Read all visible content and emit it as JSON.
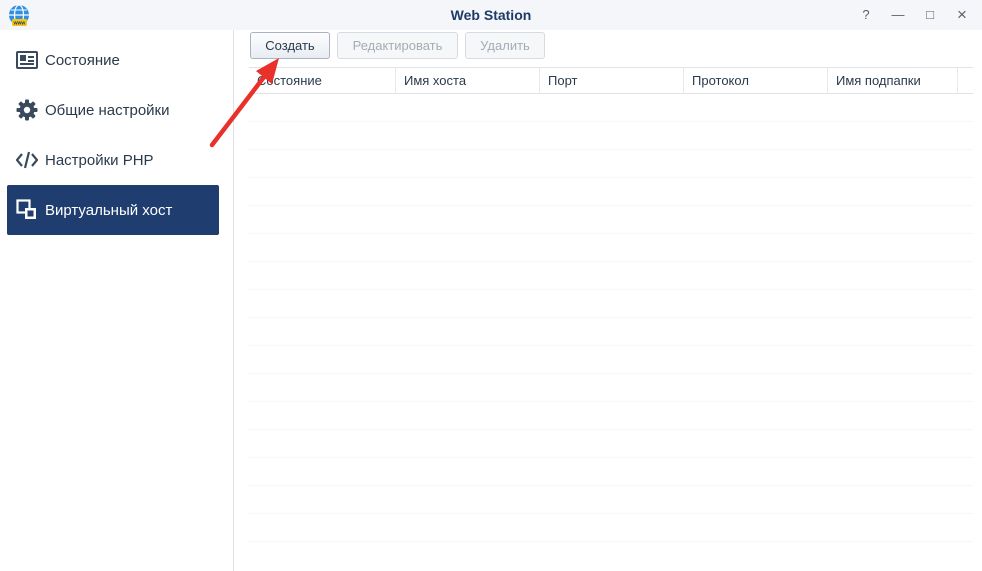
{
  "window": {
    "title": "Web Station",
    "controls": [
      "?",
      "—",
      "□",
      "×"
    ]
  },
  "sidebar": {
    "items": [
      {
        "label": "Состояние",
        "icon": "status-card-icon",
        "active": false
      },
      {
        "label": "Общие настройки",
        "icon": "gear-icon",
        "active": false
      },
      {
        "label": "Настройки PHP",
        "icon": "code-icon",
        "active": false
      },
      {
        "label": "Виртуальный хост",
        "icon": "virtual-host-icon",
        "active": true
      }
    ]
  },
  "toolbar": {
    "create_label": "Создать",
    "edit_label": "Редактировать",
    "delete_label": "Удалить"
  },
  "grid": {
    "columns": [
      "Состояние",
      "Имя хоста",
      "Порт",
      "Протокол",
      "Имя подпапки"
    ],
    "rows": []
  },
  "colors": {
    "accent": "#1f3d6e",
    "title": "#1e3b66",
    "annotation_arrow": "#e8312a"
  }
}
